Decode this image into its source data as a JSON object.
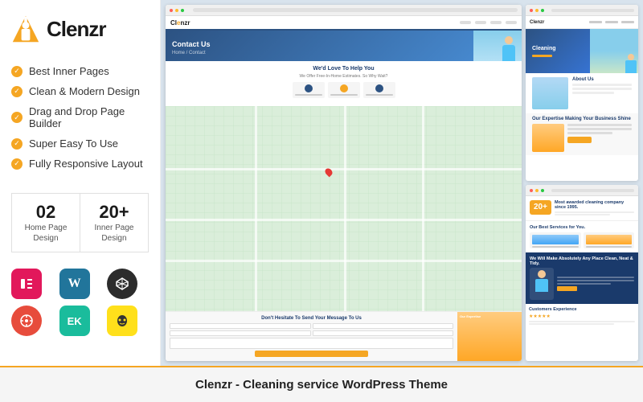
{
  "logo": {
    "text": "Clenzr",
    "icon_unicode": "🧹"
  },
  "features": [
    "Best Inner Pages",
    "Clean & Modern Design",
    "Drag and Drop Page Builder",
    "Super Easy To Use",
    "Fully Responsive Layout"
  ],
  "stats": [
    {
      "number": "02",
      "line1": "Home Page",
      "line2": "Design"
    },
    {
      "number": "20+",
      "line1": "Inner Page",
      "line2": "Design"
    }
  ],
  "plugins": [
    {
      "name": "Elementor",
      "color": "#e2185b",
      "symbol": "≡"
    },
    {
      "name": "WordPress",
      "color": "#21759b",
      "symbol": "W"
    },
    {
      "name": "CodePen",
      "color": "#2c2c2c",
      "symbol": "◉"
    },
    {
      "name": "Compass",
      "color": "#e74c3c",
      "symbol": "⊕"
    },
    {
      "name": "EK",
      "color": "#1abc9c",
      "symbol": "E"
    },
    {
      "name": "Mailchimp",
      "color": "#ffe01b",
      "symbol": "✉"
    }
  ],
  "screenshots": {
    "main": {
      "nav_logo": "Clenzr",
      "hero_title": "Contact Us",
      "hero_subtitle": "Home / Contact",
      "help_title": "We'd Love To Help You",
      "help_subtitle": "We Offer Free-In-Home Estimates. So Why Wait?",
      "contact_form_title": "Don't Hesitate To Send Your Message To Us",
      "expertise_title": "Our Expertise Making Your Business Shine"
    },
    "top_right": {
      "hero_title": "Cleaning",
      "section_title": "About Us"
    },
    "bottom_right": {
      "award_number": "20+",
      "award_title": "Most awarded cleaning company since 1995.",
      "services_title": "Our Best Services for You.",
      "make_clean_title": "We Will Make Absolutely Any Place Clean, Neat & Tidy.",
      "customers_title": "Customers Experience"
    }
  },
  "footer": {
    "title": "Clenzr - Cleaning service WordPress Theme"
  },
  "colors": {
    "accent": "#f5a623",
    "brand_blue": "#2c5282",
    "dark_text": "#1a1a1a"
  }
}
